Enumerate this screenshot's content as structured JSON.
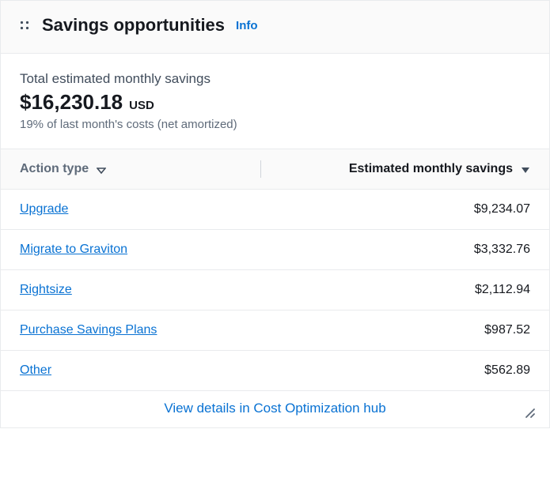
{
  "header": {
    "title": "Savings opportunities",
    "info_label": "Info"
  },
  "summary": {
    "label": "Total estimated monthly savings",
    "amount": "$16,230.18",
    "currency": "USD",
    "subtext": "19% of last month's costs (net amortized)"
  },
  "table": {
    "columns": {
      "action": "Action type",
      "savings": "Estimated monthly savings"
    },
    "rows": [
      {
        "action": "Upgrade",
        "savings": "$9,234.07"
      },
      {
        "action": "Migrate to Graviton",
        "savings": "$3,332.76"
      },
      {
        "action": "Rightsize",
        "savings": "$2,112.94"
      },
      {
        "action": "Purchase Savings Plans",
        "savings": "$987.52"
      },
      {
        "action": "Other",
        "savings": "$562.89"
      }
    ]
  },
  "footer": {
    "link": "View details in Cost Optimization hub"
  },
  "chart_data": {
    "type": "table",
    "title": "Savings opportunities",
    "columns": [
      "Action type",
      "Estimated monthly savings (USD)"
    ],
    "rows": [
      [
        "Upgrade",
        9234.07
      ],
      [
        "Migrate to Graviton",
        3332.76
      ],
      [
        "Rightsize",
        2112.94
      ],
      [
        "Purchase Savings Plans",
        987.52
      ],
      [
        "Other",
        562.89
      ]
    ],
    "total": 16230.18
  }
}
